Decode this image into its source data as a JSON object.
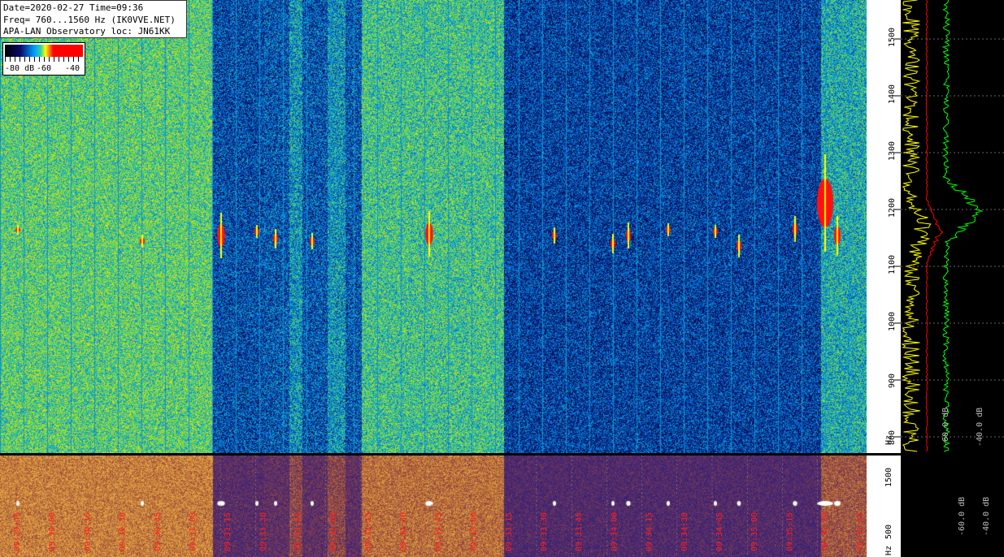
{
  "header": {
    "line1": "Date=2020-02-27 Time=09:36",
    "line2": "Freq= 760...1560 Hz (IK0VVE.NET)",
    "line3": "APA-LAN Observatory loc: JN61KK"
  },
  "legend": {
    "min_label": "-80 dB",
    "mid_label": "-60",
    "max_label": "-40"
  },
  "freq_axis": {
    "unit": "Hz",
    "ticks": [
      "1500",
      "1400",
      "1300",
      "1200",
      "1100",
      "1000",
      "900",
      "800"
    ],
    "bottom_ticks": [
      "1500",
      "500"
    ]
  },
  "spectrum_panel": {
    "db_labels": [
      "-60.0 dB",
      "-40.0 dB"
    ],
    "bottom_db_labels": [
      "-60.0 dB",
      "-40.0 dB"
    ]
  },
  "time_axis": {
    "labels": [
      "09:29:45",
      "09:30:00",
      "09:30:15",
      "09:30:30",
      "09:30:45",
      "09:31:00",
      "09:31:15",
      "09:31:30",
      "09:31:45",
      "09:32:00",
      "09:32:15",
      "09:32:30",
      "09:32:45",
      "09:33:00",
      "09:33:15",
      "09:33:30",
      "09:33:45",
      "09:34:00",
      "09:34:15",
      "09:34:30",
      "09:34:45",
      "09:35:00",
      "09:35:15",
      "09:35:30",
      "09:35:45"
    ]
  },
  "colors": {
    "spectrum_avg": "#ffff00",
    "spectrum_peak": "#00ff00",
    "spectrum_red": "#ff0000",
    "time_label": "#ff2020"
  }
}
